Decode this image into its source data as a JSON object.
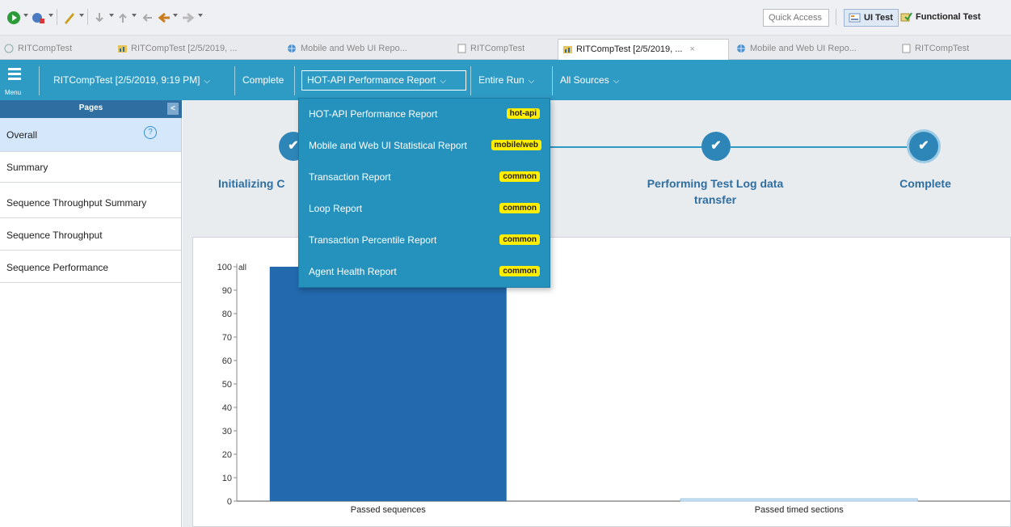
{
  "toolbar": {
    "quick_access": "Quick Access",
    "perspectives": [
      {
        "label": "UI Test",
        "icon": "ui-test-icon"
      },
      {
        "label": "Functional Test",
        "icon": "functional-test-icon"
      }
    ]
  },
  "tabs": [
    {
      "label": "RITCompTest"
    },
    {
      "label": "RITCompTest [2/5/2019, ..."
    },
    {
      "label": "Mobile and Web UI Repo..."
    },
    {
      "label": "RITCompTest"
    },
    {
      "label": "RITCompTest [2/5/2019, ...",
      "close": "×"
    },
    {
      "label": "Mobile and Web UI Repo..."
    },
    {
      "label": "RITCompTest"
    }
  ],
  "navbar": {
    "menu_label": "Menu",
    "run": "RITCompTest [2/5/2019, 9:19 PM]",
    "status": "Complete",
    "report": "HOT-API Performance Report",
    "range": "Entire Run",
    "sources": "All Sources"
  },
  "sidebar": {
    "header": "Pages",
    "collapse": "<",
    "items": [
      "Overall",
      "Summary",
      "Sequence Throughput Summary",
      "Sequence Throughput",
      "Sequence Performance"
    ],
    "help": "?"
  },
  "steps": [
    {
      "label": "Initializing C"
    },
    {
      "label": "Performing Test Log data transfer"
    },
    {
      "label": "Complete"
    }
  ],
  "check": "✔",
  "dropdown": [
    {
      "label": "HOT-API Performance Report",
      "badge": "hot-api"
    },
    {
      "label": "Mobile and Web UI Statistical Report",
      "badge": "mobile/web"
    },
    {
      "label": "Transaction Report",
      "badge": "common"
    },
    {
      "label": "Loop Report",
      "badge": "common"
    },
    {
      "label": "Transaction Percentile Report",
      "badge": "common"
    },
    {
      "label": "Agent Health Report",
      "badge": "common"
    }
  ],
  "colors": {
    "accent": "#2e9bc4",
    "bar": "#2369ad",
    "badge": "#ffee00"
  },
  "chart_data": {
    "type": "bar",
    "categories": [
      "Passed sequences",
      "Passed timed sections"
    ],
    "values": [
      100,
      0
    ],
    "ylabel": "",
    "ylim": [
      0,
      100
    ],
    "yticks": [
      0,
      10,
      20,
      30,
      40,
      50,
      60,
      70,
      80,
      90,
      100
    ],
    "corner_label": "all",
    "grid": false
  }
}
